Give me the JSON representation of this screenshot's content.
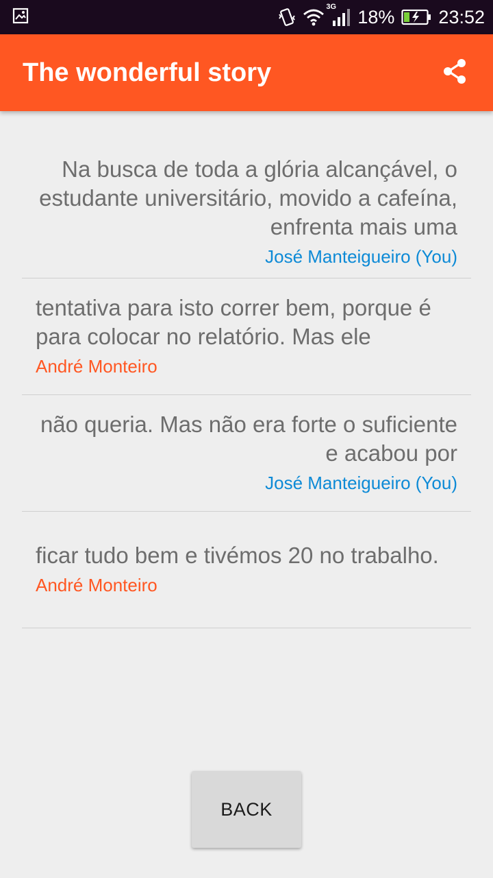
{
  "status_bar": {
    "network_type": "3G",
    "battery": "18%",
    "time": "23:52",
    "icons": [
      "gallery-icon",
      "vibrate-icon",
      "wifi-icon",
      "signal-icon",
      "battery-charging-icon"
    ]
  },
  "app_bar": {
    "title": "The wonderful story",
    "action_icon": "share-icon"
  },
  "story": [
    {
      "text": "Na busca de toda a glória alcançável, o estudante universitário, movido a cafeína, enfrenta mais uma",
      "author": "José Manteigueiro (You)",
      "is_you": true
    },
    {
      "text": "tentativa para isto correr bem, porque é para colocar no relatório. Mas ele",
      "author": "André Monteiro",
      "is_you": false
    },
    {
      "text": "não queria. Mas não era forte o suficiente e acabou por",
      "author": "José Manteigueiro (You)",
      "is_you": true
    },
    {
      "text": "ficar tudo bem e tivémos 20 no trabalho.",
      "author": "André Monteiro",
      "is_you": false
    }
  ],
  "back_button": {
    "label": "BACK"
  },
  "colors": {
    "primary": "#ff5722",
    "you_author": "#0d8ad6",
    "other_author": "#ff5722",
    "background": "#eeeeee"
  }
}
